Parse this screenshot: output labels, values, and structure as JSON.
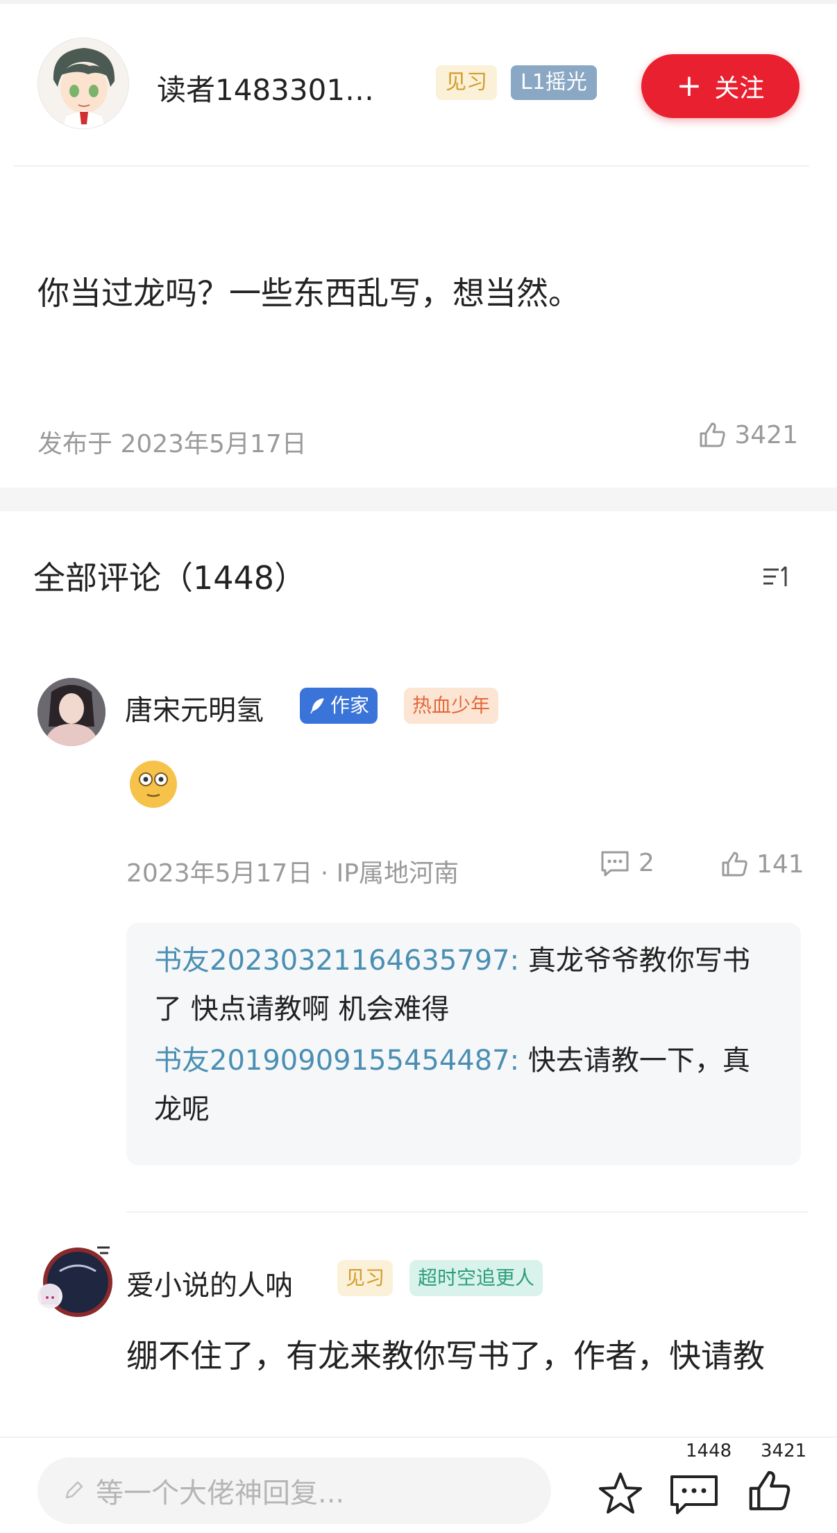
{
  "post": {
    "author_name": "读者1483301…",
    "badge_level_tag": "见习",
    "badge_level": "L1摇光",
    "follow_label": "关注",
    "content": "你当过龙吗？一些东西乱写，想当然。",
    "published": "发布于 2023年5月17日",
    "likes": "3421"
  },
  "comments_header": {
    "title": "全部评论（1448）"
  },
  "comments": [
    {
      "name": "唐宋元明氢",
      "tag_writer": "作家",
      "tag_title": "热血少年",
      "meta": "2023年5月17日 · IP属地河南",
      "reply_count": "2",
      "likes": "141",
      "replies": [
        {
          "user": "书友20230321164635797:",
          "text": " 真龙爷爷教你写书了  快点请教啊  机会难得"
        },
        {
          "user": "书友20190909155454487:",
          "text": " 快去请教一下，真龙呢"
        }
      ]
    },
    {
      "name": "爱小说的人呐",
      "tag_level": "见习",
      "tag_title": "超时空追更人",
      "text": "绷不住了，有龙来教你写书了，作者，快请教"
    }
  ],
  "bottom_bar": {
    "input_placeholder": "等一个大佬神回复...",
    "comment_count": "1448",
    "like_count": "3421"
  },
  "colors": {
    "follow": "#e8202f",
    "reply_user": "#4a8fb3",
    "writer_tag": "#3a74d8"
  }
}
